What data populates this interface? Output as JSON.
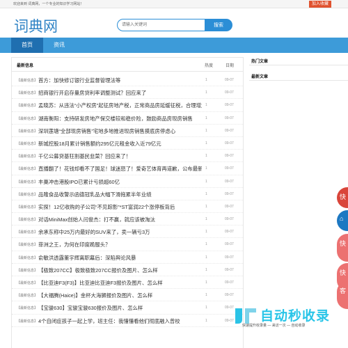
{
  "topbar": {
    "welcome": "欢迎来到 词典网，一个专业的知识学习网站！",
    "favorite_button": "加入收藏"
  },
  "header": {
    "logo_text": "词典网",
    "search_placeholder": "请输入关键词",
    "search_button": "搜索"
  },
  "nav": {
    "items": [
      {
        "label": "首页",
        "active": true
      },
      {
        "label": "资讯",
        "active": false
      }
    ]
  },
  "main": {
    "title": "最新信息",
    "col_hot": "热度",
    "col_date": "日期",
    "rows": [
      {
        "tag": "【最新信息】",
        "text": "首方：加快修订银行业监督管理法等",
        "hot": "1",
        "date": "09-07"
      },
      {
        "tag": "【最新信息】",
        "text": "招商银行开启存量房贷利率调整测试？回应来了",
        "hot": "1",
        "date": "09-07"
      },
      {
        "tag": "【最新信息】",
        "text": "孟晓苏：从违法“小产权房”起征房地产税，正常商品房延缓征税，合理增加地方",
        "hot": "1",
        "date": "09-07"
      },
      {
        "tag": "【最新信息】",
        "text": "湖南衡阳：支持研发房地产保交楼较和稳价险，鼓励商品房现房销售",
        "hot": "1",
        "date": "09-07"
      },
      {
        "tag": "【最新信息】",
        "text": "深圳莲塘“全部现房销售”宅地多地推进现房销售摸底房停虑心",
        "hot": "1",
        "date": "09-07"
      },
      {
        "tag": "【最新信息】",
        "text": "新城控股18月累计销售额约295亿元租金收入近79亿元",
        "hot": "1",
        "date": "09-07"
      },
      {
        "tag": "【最新信息】",
        "text": "千亿公募贷基狂割基民韭菜？回应来了！",
        "hot": "1",
        "date": "09-07"
      },
      {
        "tag": "【最新信息】",
        "text": "直播翻了！花钱却看不了国足！球迷怒了！爱奇艺体育再道歉，公布最新补偿方案",
        "hot": "1",
        "date": "09-07"
      },
      {
        "tag": "【最新信息】",
        "text": "丰巢冲击港股IPO已累计亏损超60亿",
        "hot": "1",
        "date": "09-07"
      },
      {
        "tag": "【最新信息】",
        "text": "品隆食品收警示函德冠乳品大幅下滑拖累半年业绩",
        "hot": "1",
        "date": "09-07"
      },
      {
        "tag": "【最新信息】",
        "text": "实探！12亿收购的子公司“不见踪影”*ST富润22个涨停板背后",
        "hot": "1",
        "date": "09-07"
      },
      {
        "tag": "【最新信息】",
        "text": "对话MiniMax创始人闫俊杰：打不赢，就应该被淘汰",
        "hot": "1",
        "date": "09-07"
      },
      {
        "tag": "【最新信息】",
        "text": "余承东称中25万内最好的SUV来了，卖一辆亏3万",
        "hot": "1",
        "date": "09-07"
      },
      {
        "tag": "【最新信息】",
        "text": "菲洲之王，为何在印度跪服头？",
        "hot": "1",
        "date": "09-07"
      },
      {
        "tag": "【最新信息】",
        "text": "俞敏洪透露董宇辉离职幕后：深陷舆论风暴",
        "hot": "1",
        "date": "09-07"
      },
      {
        "tag": "【最新信息】",
        "text": "【极致207CC】极致极致207CC报价及图片、怎么样",
        "hot": "1",
        "date": "09-07"
      },
      {
        "tag": "【最新信息】",
        "text": "【比亚迪F3(F3)】比亚迪比亚迪F3报价及图片、怎么样",
        "hot": "1",
        "date": "09-07"
      },
      {
        "tag": "【最新信息】",
        "text": "【大福腾(Haice)】金杯大海狮报价及图片、怎么样",
        "hot": "1",
        "date": "09-07"
      },
      {
        "tag": "【最新信息】",
        "text": "【宝骏630】宝骏宝骏630报价及图片、怎么样",
        "hot": "1",
        "date": "09-07"
      },
      {
        "tag": "【最新信息】",
        "text": "4个自闭症孩子一起上学，班主任：我懂懂看他们彻底融入曾校",
        "hot": "1",
        "date": "09-07"
      }
    ]
  },
  "side": {
    "hot_title": "热门文章",
    "new_title": "最新文章"
  },
  "float_buttons": [
    {
      "label": "快",
      "color": "#d9453a"
    },
    {
      "label": "⌂",
      "color": "#1d78c2"
    },
    {
      "label": "快",
      "color": "#ec7171"
    },
    {
      "label": "快",
      "color": "#ec7171"
    },
    {
      "label": "客",
      "color": "#ec7171"
    }
  ],
  "watermark": {
    "text": "自动秒收录",
    "sub": "快速提升收录量 — 来访一次 — 自动收录"
  }
}
